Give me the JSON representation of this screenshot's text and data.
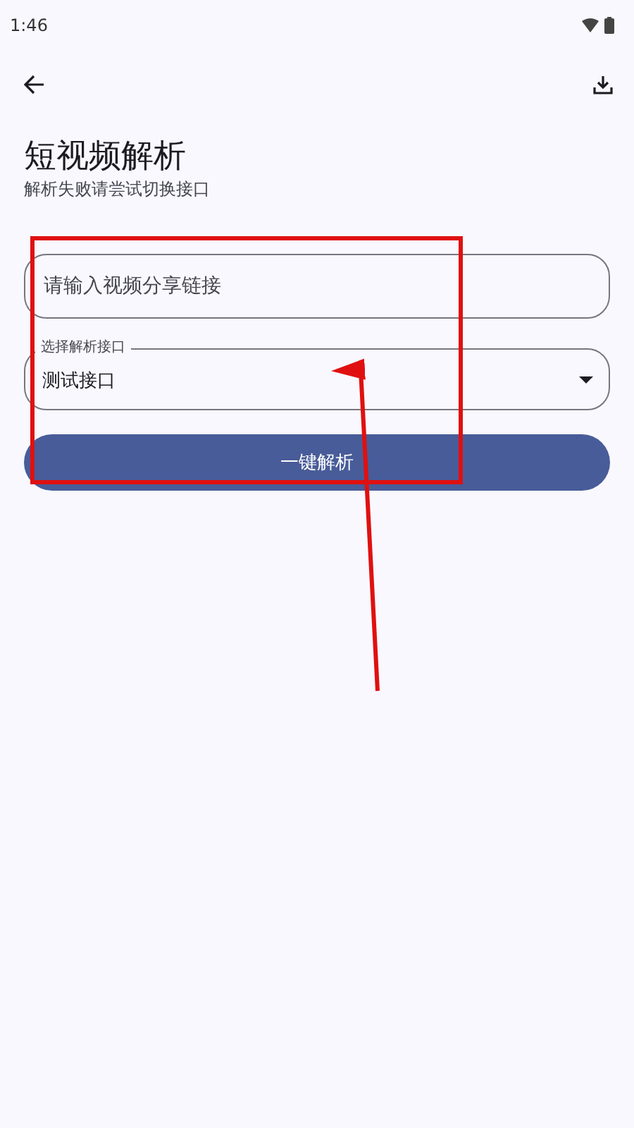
{
  "status_bar": {
    "time": "1:46"
  },
  "header": {
    "title": "短视频解析",
    "subtitle": "解析失败请尝试切换接口"
  },
  "link_field": {
    "placeholder": "请输入视频分享链接"
  },
  "api_select": {
    "label": "选择解析接口",
    "value": "测试接口"
  },
  "parse_button": {
    "label": "一键解析"
  }
}
